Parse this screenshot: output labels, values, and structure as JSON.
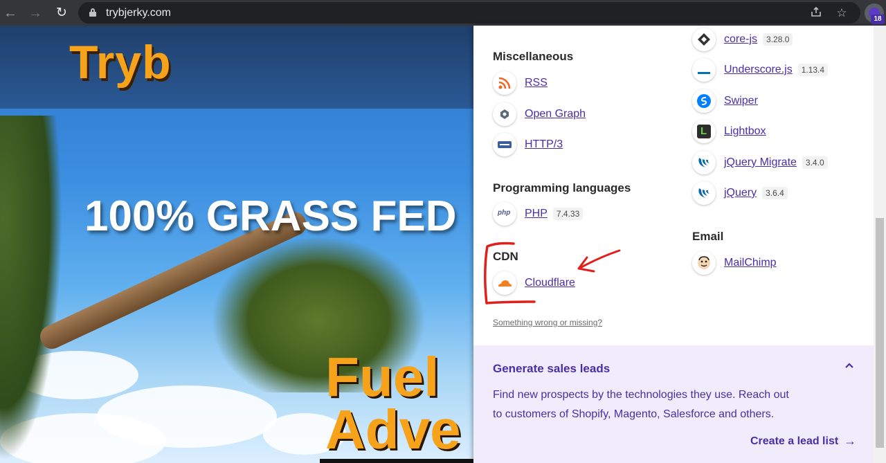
{
  "browser": {
    "url": "trybjerky.com",
    "extension_badge": "18"
  },
  "site": {
    "logo": "Tryb",
    "hero_title": "100% GRASS FED",
    "hero_sub_line1": "Fuel",
    "hero_sub_line2": "Adve"
  },
  "panel": {
    "categories": {
      "misc": "Miscellaneous",
      "programming": "Programming languages",
      "cdn": "CDN",
      "email": "Email"
    },
    "misc_items": [
      {
        "name": "RSS",
        "icon": "rss-icon"
      },
      {
        "name": "Open Graph",
        "icon": "open-graph-icon"
      },
      {
        "name": "HTTP/3",
        "icon": "http3-icon"
      }
    ],
    "programming_items": [
      {
        "name": "PHP",
        "version": "7.4.33",
        "icon": "php-icon"
      }
    ],
    "cdn_items": [
      {
        "name": "Cloudflare",
        "icon": "cloudflare-icon"
      }
    ],
    "right_items": [
      {
        "name": "core-js",
        "version": "3.28.0",
        "icon": "core-js-icon"
      },
      {
        "name": "Underscore.js",
        "version": "1.13.4",
        "icon": "underscore-icon"
      },
      {
        "name": "Swiper",
        "icon": "swiper-icon"
      },
      {
        "name": "Lightbox",
        "icon": "lightbox-icon"
      },
      {
        "name": "jQuery Migrate",
        "version": "3.4.0",
        "icon": "jquery-migrate-icon"
      },
      {
        "name": "jQuery",
        "version": "3.6.4",
        "icon": "jquery-icon"
      }
    ],
    "email_items": [
      {
        "name": "MailChimp",
        "icon": "mailchimp-icon"
      }
    ],
    "something_wrong": "Something wrong or missing?",
    "leads": {
      "title": "Generate sales leads",
      "text_line1": "Find new prospects by the technologies they use. Reach out",
      "text_line2": "to customers of Shopify, Magento, Salesforce and others.",
      "link": "Create a lead list"
    }
  },
  "colors": {
    "accent": "#4a2da8",
    "annotation": "#e0201c"
  }
}
